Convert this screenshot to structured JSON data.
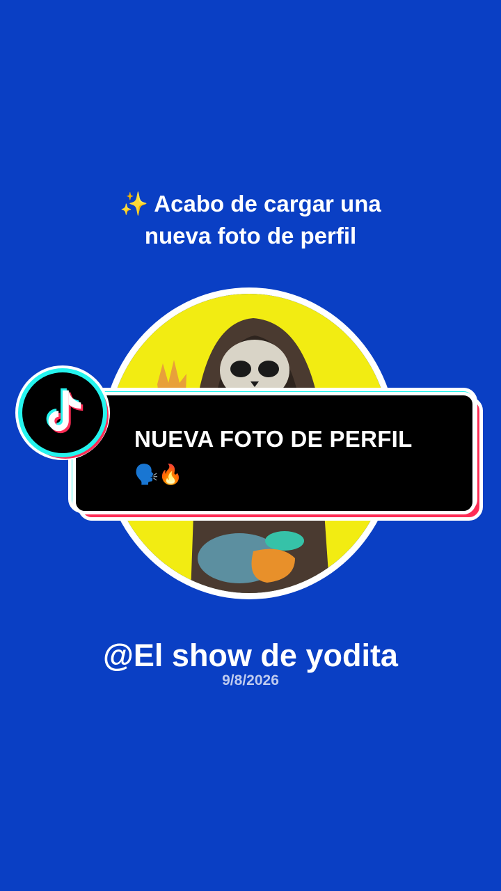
{
  "header": {
    "line1": "✨ Acabo de cargar una",
    "line2": "nueva foto de perfil"
  },
  "banner": {
    "title": "NUEVA FOTO DE PERFIL",
    "emojis": "🗣️🔥"
  },
  "profile": {
    "username": "@El show de yodita",
    "date": "9/8/2026"
  },
  "icons": {
    "badge": "tiktok-logo-icon",
    "avatar": "hooded-skull-avatar"
  },
  "colors": {
    "background": "#0A3FC4",
    "cyan": "#25F4EE",
    "red": "#FE2C55",
    "avatar_bg": "#F2EC12"
  }
}
